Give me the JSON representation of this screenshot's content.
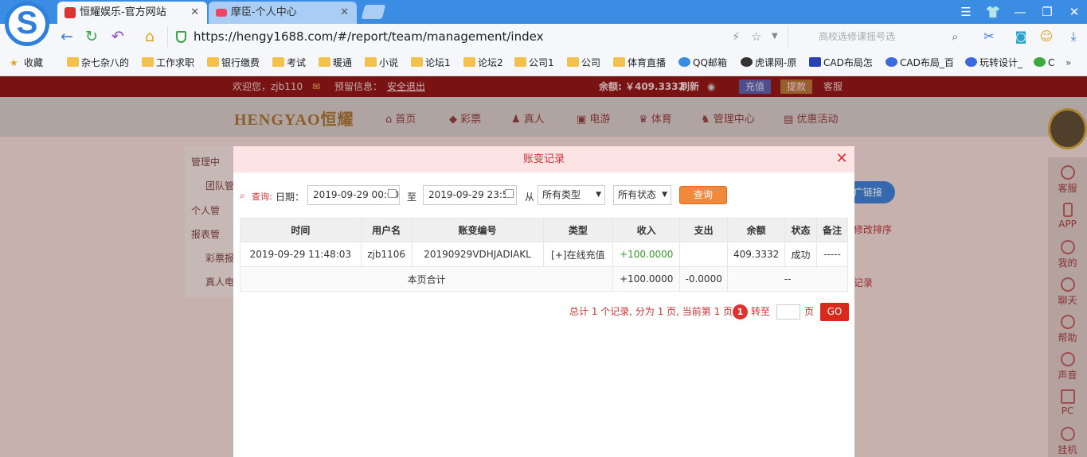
{
  "browser": {
    "tabs": [
      {
        "label": "恒耀娱乐-官方网站",
        "close": "✕"
      },
      {
        "label": "摩臣-个人中心",
        "close": "✕"
      }
    ],
    "url": "https://hengy1688.com/#/report/team/management/index",
    "search_placeholder": "高校选修课摇号选",
    "bookmarks": [
      "收藏",
      "杂七杂八的",
      "工作求职",
      "银行缴费",
      "考试",
      "暖通",
      "小说",
      "论坛1",
      "论坛2",
      "公司1",
      "公司",
      "体育直播",
      "QQ邮箱",
      "虎课网-原",
      "CAD布局怎",
      "CAD布局_百",
      "玩转设计_",
      "C"
    ]
  },
  "site": {
    "welcome": "欢迎您，zjb110",
    "notice_label": "预留信息：",
    "logout": "安全退出",
    "balance": "余额: ￥409.3332",
    "refresh": "刷新",
    "recharge": "充值",
    "withdraw": "提款",
    "service": "客服",
    "logo": "HENGYAO恒耀",
    "nav": [
      "首页",
      "彩票",
      "真人",
      "电游",
      "体育",
      "管理中心",
      "优惠活动"
    ],
    "side": [
      "管理中",
      "团队管",
      "个人管",
      "报表管",
      "彩票报",
      "真人电"
    ],
    "right_bar": [
      "客服",
      "APP",
      "我的",
      "聊天",
      "帮助",
      "声音",
      "PC",
      "挂机"
    ],
    "behind_texts": [
      "广链接",
      "修改排序",
      "记录"
    ]
  },
  "modal": {
    "title": "账变记录",
    "close": "✕",
    "query_label": "查询:",
    "date_label": "日期：",
    "date_from": "2019-09-29 00:00",
    "to_label": "至",
    "date_to": "2019-09-29 23:59",
    "from_label": "从",
    "type_select": "所有类型",
    "status_select": "所有状态",
    "query_button": "查询",
    "table": {
      "headers": [
        "时间",
        "用户名",
        "账变编号",
        "类型",
        "收入",
        "支出",
        "余额",
        "状态",
        "备注"
      ],
      "rows": [
        [
          "2019-09-29 11:48:03",
          "zjb1106",
          "20190929VDHJADIAKL",
          "[+]在线充值",
          "+100.0000",
          "",
          "409.3332",
          "成功",
          "-----"
        ]
      ],
      "summary": {
        "label": "本页合计",
        "income": "+100.0000",
        "expense": "-0.0000",
        "rest": "--"
      }
    },
    "pager": {
      "text": "总计 1 个记录, 分为 1 页, 当前第 1 页",
      "current": "1",
      "goto_label": "转至",
      "page_label": "页",
      "go": "GO"
    }
  }
}
